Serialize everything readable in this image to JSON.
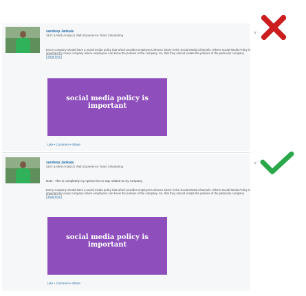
{
  "posts": [
    {
      "name": "sandeep Jankala",
      "headline": "SEO & Web Analyst | Web Experience Team | Marketing",
      "menu_label": "∨",
      "body": "Every company should have a social media policy that which provides employees what to Share in the Social Media Channels. Where Social Media Policy is important for every company where employees can know the policies of the company. So, that they cannot violate the policies of the particular company",
      "show_less": "show less",
      "card_text": "social media policy is important",
      "actions": "Like • Comment • Share",
      "verdict_icon": "x-mark-icon",
      "verdict_color": "#cc1e1e"
    },
    {
      "name": "sandeep Jankala",
      "headline": "SEO & Web Analyst | Web Experience Team | Marketing",
      "menu_label": "∨",
      "note": "Note : This is completely my opinion its no way related to my company",
      "body": "Every company should have a social media policy that which provides employees what to Share in the Social Media Channels. Where Social Media Policy is important for every company where employees can know the policies of the company. So, that they cannot violate the policies of the particular company",
      "show_less": "show less",
      "card_text": "social media policy is important",
      "actions": "Like • Comment • Share",
      "verdict_icon": "check-mark-icon",
      "verdict_color": "#2aa84a"
    }
  ]
}
